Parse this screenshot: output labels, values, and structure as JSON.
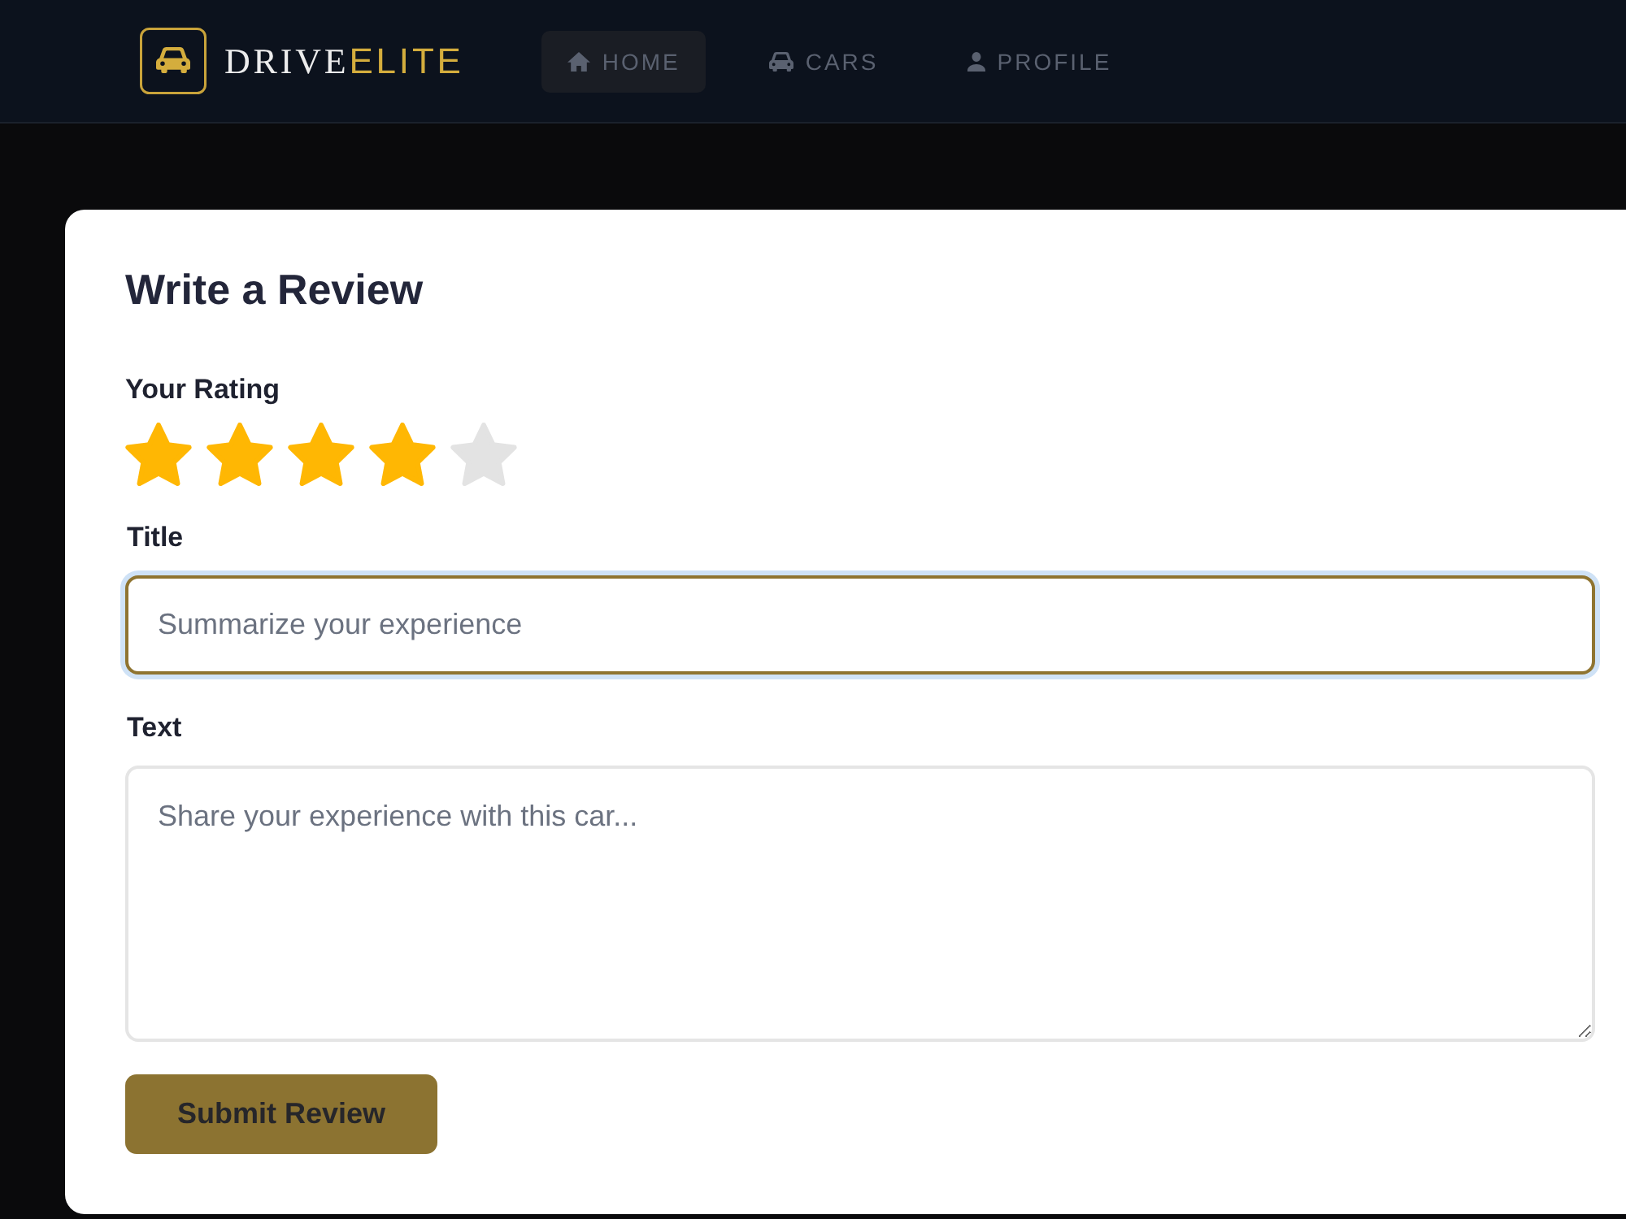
{
  "header": {
    "brand": {
      "name": "DRIVE",
      "accent": "ELITE"
    },
    "nav": [
      {
        "label": "HOME",
        "selected": true
      },
      {
        "label": "CARS",
        "selected": false
      },
      {
        "label": "PROFILE",
        "selected": false
      }
    ]
  },
  "review_form": {
    "title": "Write a Review",
    "rating": {
      "label": "Your Rating",
      "stars": 4
    },
    "fields": [
      {
        "kind": "input",
        "label": "Title",
        "placeholder": "Summarize your experience",
        "focused": true
      },
      {
        "kind": "textarea",
        "label": "Text",
        "placeholder": "Share your experience with this car...",
        "focused": false
      }
    ],
    "submit_button": "Submit Review"
  }
}
